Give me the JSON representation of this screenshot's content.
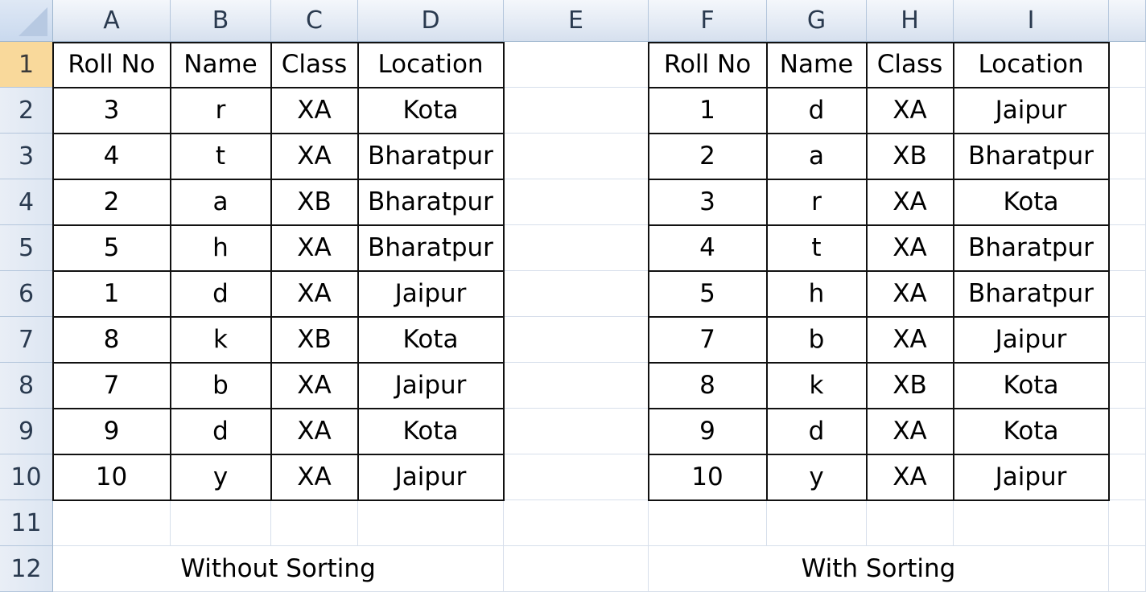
{
  "columns": [
    "A",
    "B",
    "C",
    "D",
    "E",
    "F",
    "G",
    "H",
    "I"
  ],
  "rows": [
    "1",
    "2",
    "3",
    "4",
    "5",
    "6",
    "7",
    "8",
    "9",
    "10",
    "11",
    "12"
  ],
  "selected_row": "1",
  "left_table": {
    "headers": [
      "Roll No",
      "Name",
      "Class",
      "Location"
    ],
    "rows": [
      [
        "3",
        "r",
        "XA",
        "Kota"
      ],
      [
        "4",
        "t",
        "XA",
        "Bharatpur"
      ],
      [
        "2",
        "a",
        "XB",
        "Bharatpur"
      ],
      [
        "5",
        "h",
        "XA",
        "Bharatpur"
      ],
      [
        "1",
        "d",
        "XA",
        "Jaipur"
      ],
      [
        "8",
        "k",
        "XB",
        "Kota"
      ],
      [
        "7",
        "b",
        "XA",
        "Jaipur"
      ],
      [
        "9",
        "d",
        "XA",
        "Kota"
      ],
      [
        "10",
        "y",
        "XA",
        "Jaipur"
      ]
    ],
    "caption": "Without Sorting"
  },
  "right_table": {
    "headers": [
      "Roll No",
      "Name",
      "Class",
      "Location"
    ],
    "rows": [
      [
        "1",
        "d",
        "XA",
        "Jaipur"
      ],
      [
        "2",
        "a",
        "XB",
        "Bharatpur"
      ],
      [
        "3",
        "r",
        "XA",
        "Kota"
      ],
      [
        "4",
        "t",
        "XA",
        "Bharatpur"
      ],
      [
        "5",
        "h",
        "XA",
        "Bharatpur"
      ],
      [
        "7",
        "b",
        "XA",
        "Jaipur"
      ],
      [
        "8",
        "k",
        "XB",
        "Kota"
      ],
      [
        "9",
        "d",
        "XA",
        "Kota"
      ],
      [
        "10",
        "y",
        "XA",
        "Jaipur"
      ]
    ],
    "caption": "With Sorting"
  },
  "colors": {
    "header_bg": "#dfe8f5",
    "selected_row_header": "#f9d99b",
    "gridline": "#d7dfeb",
    "table_border": "#111111"
  }
}
